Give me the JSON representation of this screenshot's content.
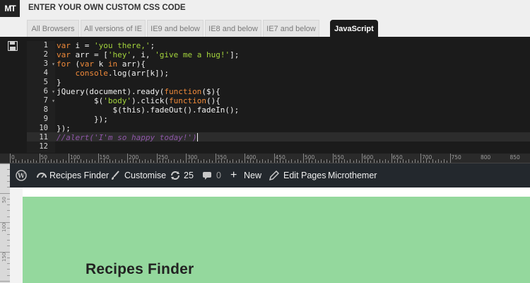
{
  "app": {
    "logo_text": "MT",
    "header_title": "ENTER YOUR OWN CUSTOM CSS CODE"
  },
  "tabs": [
    {
      "label": "All Browsers",
      "active": false
    },
    {
      "label": "All versions of IE",
      "active": false
    },
    {
      "label": "IE9 and below",
      "active": false
    },
    {
      "label": "IE8 and below",
      "active": false
    },
    {
      "label": "IE7 and below",
      "active": false
    },
    {
      "label": "JavaScript",
      "active": true
    }
  ],
  "editor": {
    "save_icon": "floppy-disk-icon",
    "line_numbers": [
      "1",
      "2",
      "3",
      "4",
      "5",
      "6",
      "7",
      "8",
      "9",
      "10",
      "11",
      "12"
    ],
    "folds": [
      false,
      false,
      true,
      false,
      false,
      true,
      true,
      false,
      false,
      false,
      false,
      false
    ],
    "active_line": 11
  },
  "ruler": {
    "labels": [
      "0",
      "50",
      "100",
      "150",
      "200",
      "250",
      "300",
      "350",
      "400",
      "450",
      "500",
      "550",
      "600",
      "650",
      "700",
      "750",
      "800",
      "850"
    ]
  },
  "vertical_ruler": {
    "labels": [
      "50",
      "100",
      "150"
    ]
  },
  "adminbar": {
    "items": {
      "wp_logo": "wordpress-icon",
      "site_name": "Recipes Finder",
      "customise": "Customise",
      "updates_count": "25",
      "comments_count": "0",
      "new": "New",
      "edit_pages": "Edit Pages",
      "microthemer": "Microthemer"
    }
  },
  "site": {
    "title": "Recipes Finder",
    "hero_color": "#94d89d"
  },
  "colors": {
    "editor_bg": "#1b1b1b",
    "keyword": "#f08a3a",
    "string": "#a3d33c",
    "comment": "#8e56a8",
    "adminbar_bg": "#23282d"
  }
}
